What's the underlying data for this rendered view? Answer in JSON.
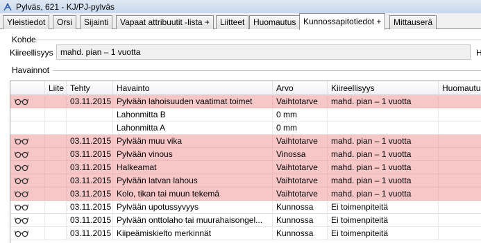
{
  "window": {
    "title": "Pylväs, 621 - KJ/PJ-pylväs"
  },
  "tabs": [
    {
      "label": "Yleistiedot",
      "active": false
    },
    {
      "label": "Orsi",
      "active": false
    },
    {
      "label": "Sijainti",
      "active": false
    },
    {
      "label": "Vapaat attribuutit -lista +",
      "active": false
    },
    {
      "label": "Liitteet",
      "active": false
    },
    {
      "label": "Huomautus",
      "active": false
    },
    {
      "label": "Kunnossapitotiedot +",
      "active": true
    },
    {
      "label": "Mittauserä",
      "active": false
    }
  ],
  "kohde": {
    "group_label": "Kohde",
    "kiireellisyys_label": "Kiireellisyys",
    "kiireellisyys_value": "mahd. pian – 1 vuotta",
    "cut_label": "H"
  },
  "havainnot": {
    "group_label": "Havainnot",
    "columns": [
      "",
      "Liite",
      "Tehty",
      "Havainto",
      "Arvo",
      "Kiireellisyys",
      "Huomautus"
    ],
    "rows": [
      {
        "highlight": true,
        "icon": "glasses-icon",
        "liite": "",
        "tehty": "03.11.2015",
        "havainto": "Pylvään lahoisuuden vaatimat toimet",
        "arvo": "Vaihtotarve",
        "kiireellisyys": "mahd. pian – 1 vuotta",
        "huomautus": ""
      },
      {
        "highlight": false,
        "icon": "",
        "liite": "",
        "tehty": "",
        "havainto": "Lahonmitta B",
        "arvo": "0 mm",
        "kiireellisyys": "",
        "huomautus": ""
      },
      {
        "highlight": false,
        "icon": "",
        "liite": "",
        "tehty": "",
        "havainto": "Lahonmitta A",
        "arvo": "0 mm",
        "kiireellisyys": "",
        "huomautus": ""
      },
      {
        "highlight": true,
        "icon": "glasses-icon",
        "liite": "",
        "tehty": "03.11.2015",
        "havainto": "Pylvään muu vika",
        "arvo": "Vaihtotarve",
        "kiireellisyys": "mahd. pian – 1 vuotta",
        "huomautus": ""
      },
      {
        "highlight": true,
        "icon": "glasses-icon",
        "liite": "",
        "tehty": "03.11.2015",
        "havainto": "Pylvään vinous",
        "arvo": "Vinossa",
        "kiireellisyys": "mahd. pian – 1 vuotta",
        "huomautus": ""
      },
      {
        "highlight": true,
        "icon": "glasses-icon",
        "liite": "",
        "tehty": "03.11.2015",
        "havainto": "Halkeamat",
        "arvo": "Vaihtotarve",
        "kiireellisyys": "mahd. pian – 1 vuotta",
        "huomautus": ""
      },
      {
        "highlight": true,
        "icon": "glasses-icon",
        "liite": "",
        "tehty": "03.11.2015",
        "havainto": "Pylvään latvan lahous",
        "arvo": "Vaihtotarve",
        "kiireellisyys": "mahd. pian – 1 vuotta",
        "huomautus": ""
      },
      {
        "highlight": true,
        "icon": "glasses-icon",
        "liite": "",
        "tehty": "03.11.2015",
        "havainto": "Kolo, tikan tai muun tekemä",
        "arvo": "Vaihtotarve",
        "kiireellisyys": "mahd. pian – 1 vuotta",
        "huomautus": ""
      },
      {
        "highlight": false,
        "icon": "glasses-icon",
        "liite": "",
        "tehty": "03.11.2015",
        "havainto": "Pylvään upotussyvyys",
        "arvo": "Kunnossa",
        "kiireellisyys": "Ei toimenpiteitä",
        "huomautus": ""
      },
      {
        "highlight": false,
        "icon": "glasses-icon",
        "liite": "",
        "tehty": "03.11.2015",
        "havainto": "Pylvään onttolaho tai muurahaisongel...",
        "arvo": "Kunnossa",
        "kiireellisyys": "Ei toimenpiteitä",
        "huomautus": ""
      },
      {
        "highlight": false,
        "icon": "glasses-icon",
        "liite": "",
        "tehty": "03.11.2015",
        "havainto": "Kiipeämiskielto merkinnät",
        "arvo": "Kunnossa",
        "kiireellisyys": "Ei toimenpiteitä",
        "huomautus": ""
      }
    ]
  },
  "colors": {
    "highlight_row": "#f7c6c7",
    "titlebar": "#c7d7ea"
  }
}
